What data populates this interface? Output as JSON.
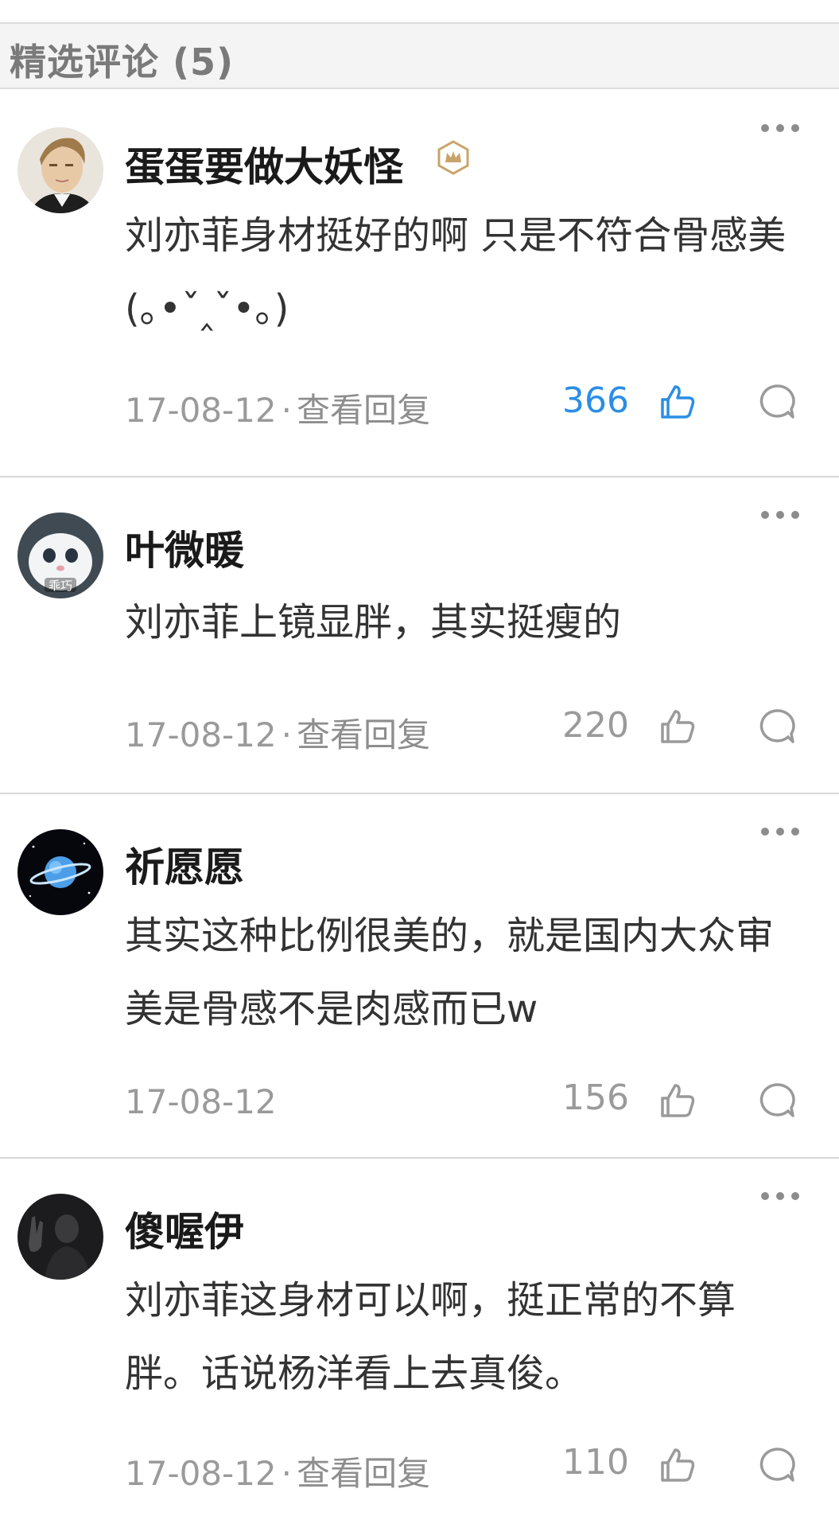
{
  "header": {
    "title": "精选评论 (5)"
  },
  "comments": [
    {
      "username": "蛋蛋要做大妖怪",
      "has_badge": true,
      "text": "刘亦菲身材挺好的啊 只是不符合骨感美(｡•ˇ‸ˇ•｡)",
      "date": "17-08-12",
      "separator": "·",
      "replies_label": "查看回复",
      "likes": "366",
      "liked": true,
      "avatar_icon": "portrait-avatar-icon"
    },
    {
      "username": "叶微暖",
      "has_badge": false,
      "text": "刘亦菲上镜显胖，其实挺瘦的",
      "date": "17-08-12",
      "separator": "·",
      "replies_label": "查看回复",
      "likes": "220",
      "liked": false,
      "avatar_text": "乖巧",
      "avatar_icon": "white-bunny-avatar-icon"
    },
    {
      "username": "祈愿愿",
      "has_badge": false,
      "text": "其实这种比例很美的，就是国内大众审美是骨感不是肉感而已w",
      "date": "17-08-12",
      "likes": "156",
      "liked": false,
      "avatar_icon": "planet-avatar-icon"
    },
    {
      "username": "傻喔伊",
      "has_badge": false,
      "text": "刘亦菲这身材可以啊，挺正常的不算胖。话说杨洋看上去真俊。",
      "date": "17-08-12",
      "separator": "·",
      "replies_label": "查看回复",
      "likes": "110",
      "liked": false,
      "avatar_icon": "dark-photo-avatar-icon"
    }
  ],
  "colors": {
    "like_active": "#2a8ee6",
    "muted": "#9a9a9a",
    "badge_gold": "#c9a46a"
  }
}
